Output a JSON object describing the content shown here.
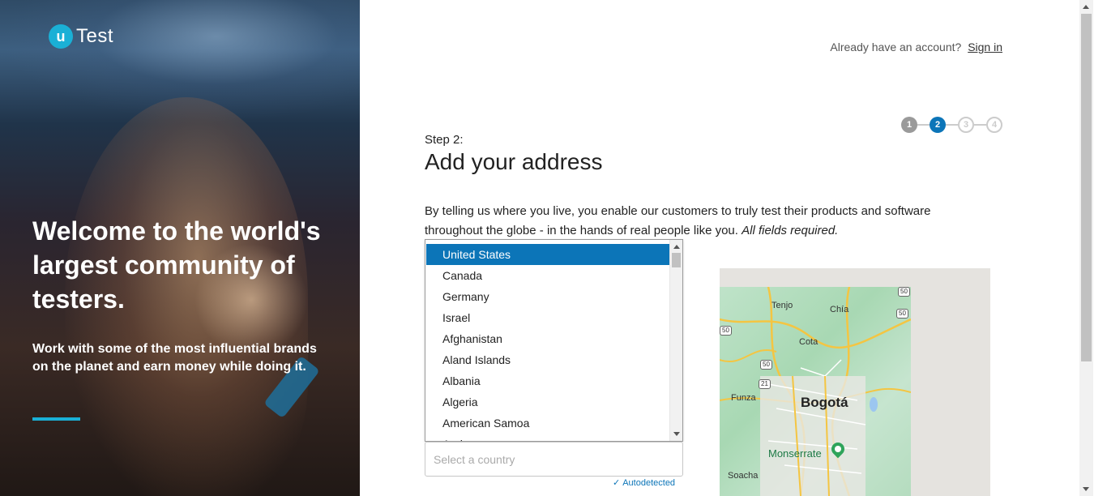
{
  "brand": {
    "logo_letter": "u",
    "logo_text": "Test",
    "accent": "#1ab0d6"
  },
  "hero": {
    "title": "Welcome to the world's largest community of testers.",
    "subtitle": "Work with some of the most influential brands on the planet and earn money while doing it."
  },
  "header": {
    "account_prompt": "Already have an account?",
    "sign_in": "Sign in"
  },
  "steps": {
    "items": [
      "1",
      "2",
      "3",
      "4"
    ],
    "current": 2
  },
  "form": {
    "step_label": "Step 2:",
    "title": "Add your address",
    "intro": "By telling us where you live, you enable our customers to truly test their products and software throughout the globe - in the hands of real people like you.",
    "intro_emphasis": "All fields required.",
    "country_placeholder": "Select a country",
    "autodetected": "Autodetected"
  },
  "country_dropdown": {
    "selected": "United States",
    "options": [
      "United States",
      "Canada",
      "Germany",
      "Israel",
      "Afghanistan",
      "Aland Islands",
      "Albania",
      "Algeria",
      "American Samoa",
      "Andorra"
    ]
  },
  "map": {
    "labels": [
      "Tenjo",
      "Chía",
      "Cota",
      "Funza",
      "Bogotá",
      "Monserrate",
      "Soacha"
    ],
    "road_signs": [
      "50",
      "50",
      "21",
      "50",
      "50"
    ]
  },
  "colors": {
    "primary": "#0c75b8",
    "step_done": "#9a9a9a",
    "error": "#d9534f"
  }
}
